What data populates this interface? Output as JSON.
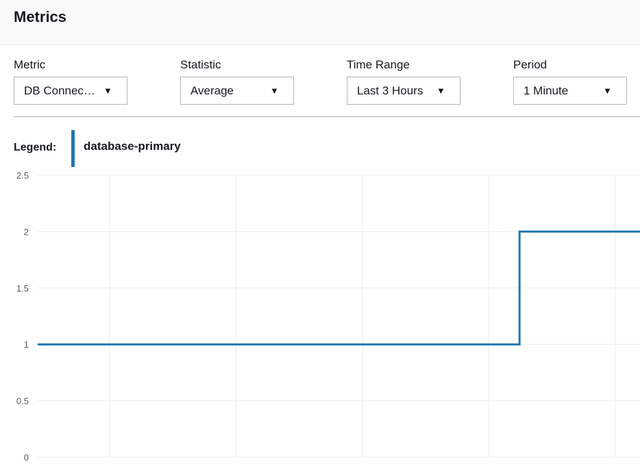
{
  "header": {
    "title": "Metrics"
  },
  "controls": {
    "metric": {
      "label": "Metric",
      "value": "DB Connec…"
    },
    "statistic": {
      "label": "Statistic",
      "value": "Average"
    },
    "time_range": {
      "label": "Time Range",
      "value": "Last 3 Hours"
    },
    "period": {
      "label": "Period",
      "value": "1 Minute"
    }
  },
  "legend": {
    "title": "Legend:",
    "series_name": "database-primary"
  },
  "colors": {
    "series": "#1f77b4",
    "grid": "#eaeded"
  },
  "chart_data": {
    "type": "line",
    "title": "",
    "xlabel": "",
    "ylabel": "",
    "ylim": [
      0,
      2.5
    ],
    "y_ticks": [
      "0",
      "0.5",
      "1",
      "1.5",
      "2",
      "2.5"
    ],
    "x": [
      0,
      0.8,
      0.8,
      1.0
    ],
    "series": [
      {
        "name": "database-primary",
        "values": [
          1,
          1,
          2,
          2
        ]
      }
    ],
    "grid": true,
    "legend_position": "top-left"
  }
}
